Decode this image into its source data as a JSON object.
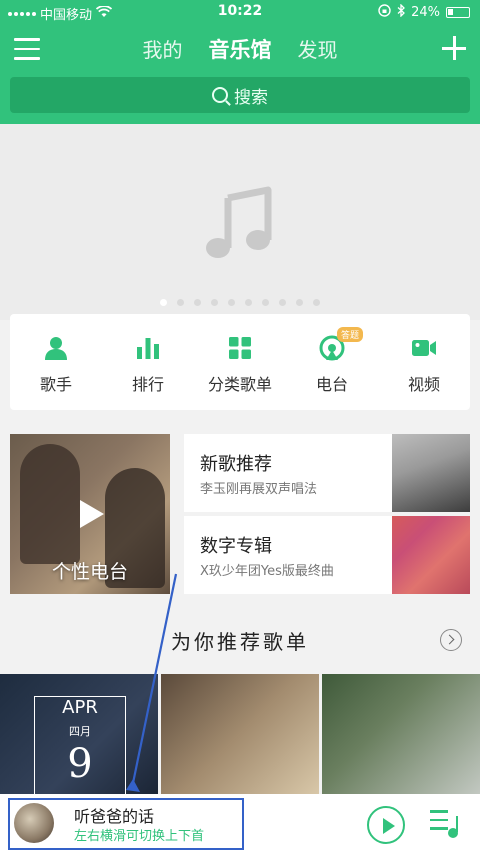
{
  "status": {
    "carrier": "中国移动",
    "time": "10:22",
    "battery": "24%"
  },
  "header": {
    "tabs": [
      "我的",
      "音乐馆",
      "发现"
    ],
    "active_tab": 1,
    "search_placeholder": "搜索"
  },
  "banner": {
    "dots": 10,
    "active_dot": 0
  },
  "categories": [
    {
      "label": "歌手",
      "icon": "singer-icon"
    },
    {
      "label": "排行",
      "icon": "chart-icon"
    },
    {
      "label": "分类歌单",
      "icon": "grid-icon"
    },
    {
      "label": "电台",
      "icon": "radio-icon",
      "badge": "答题"
    },
    {
      "label": "视频",
      "icon": "video-icon"
    }
  ],
  "radio": {
    "label": "个性电台"
  },
  "cards": [
    {
      "title": "新歌推荐",
      "subtitle": "李玉刚再展双声唱法"
    },
    {
      "title": "数字专辑",
      "subtitle": "X玖少年团Yes版最终曲"
    }
  ],
  "recommend": {
    "title": "为你推荐歌单"
  },
  "tile1": {
    "month_en": "APR",
    "month_cn": "四月",
    "day": "9"
  },
  "player": {
    "song": "听爸爸的话",
    "hint": "左右横滑可切换上下首"
  },
  "colors": {
    "accent": "#31c27c",
    "highlight_box": "#3461c8"
  }
}
